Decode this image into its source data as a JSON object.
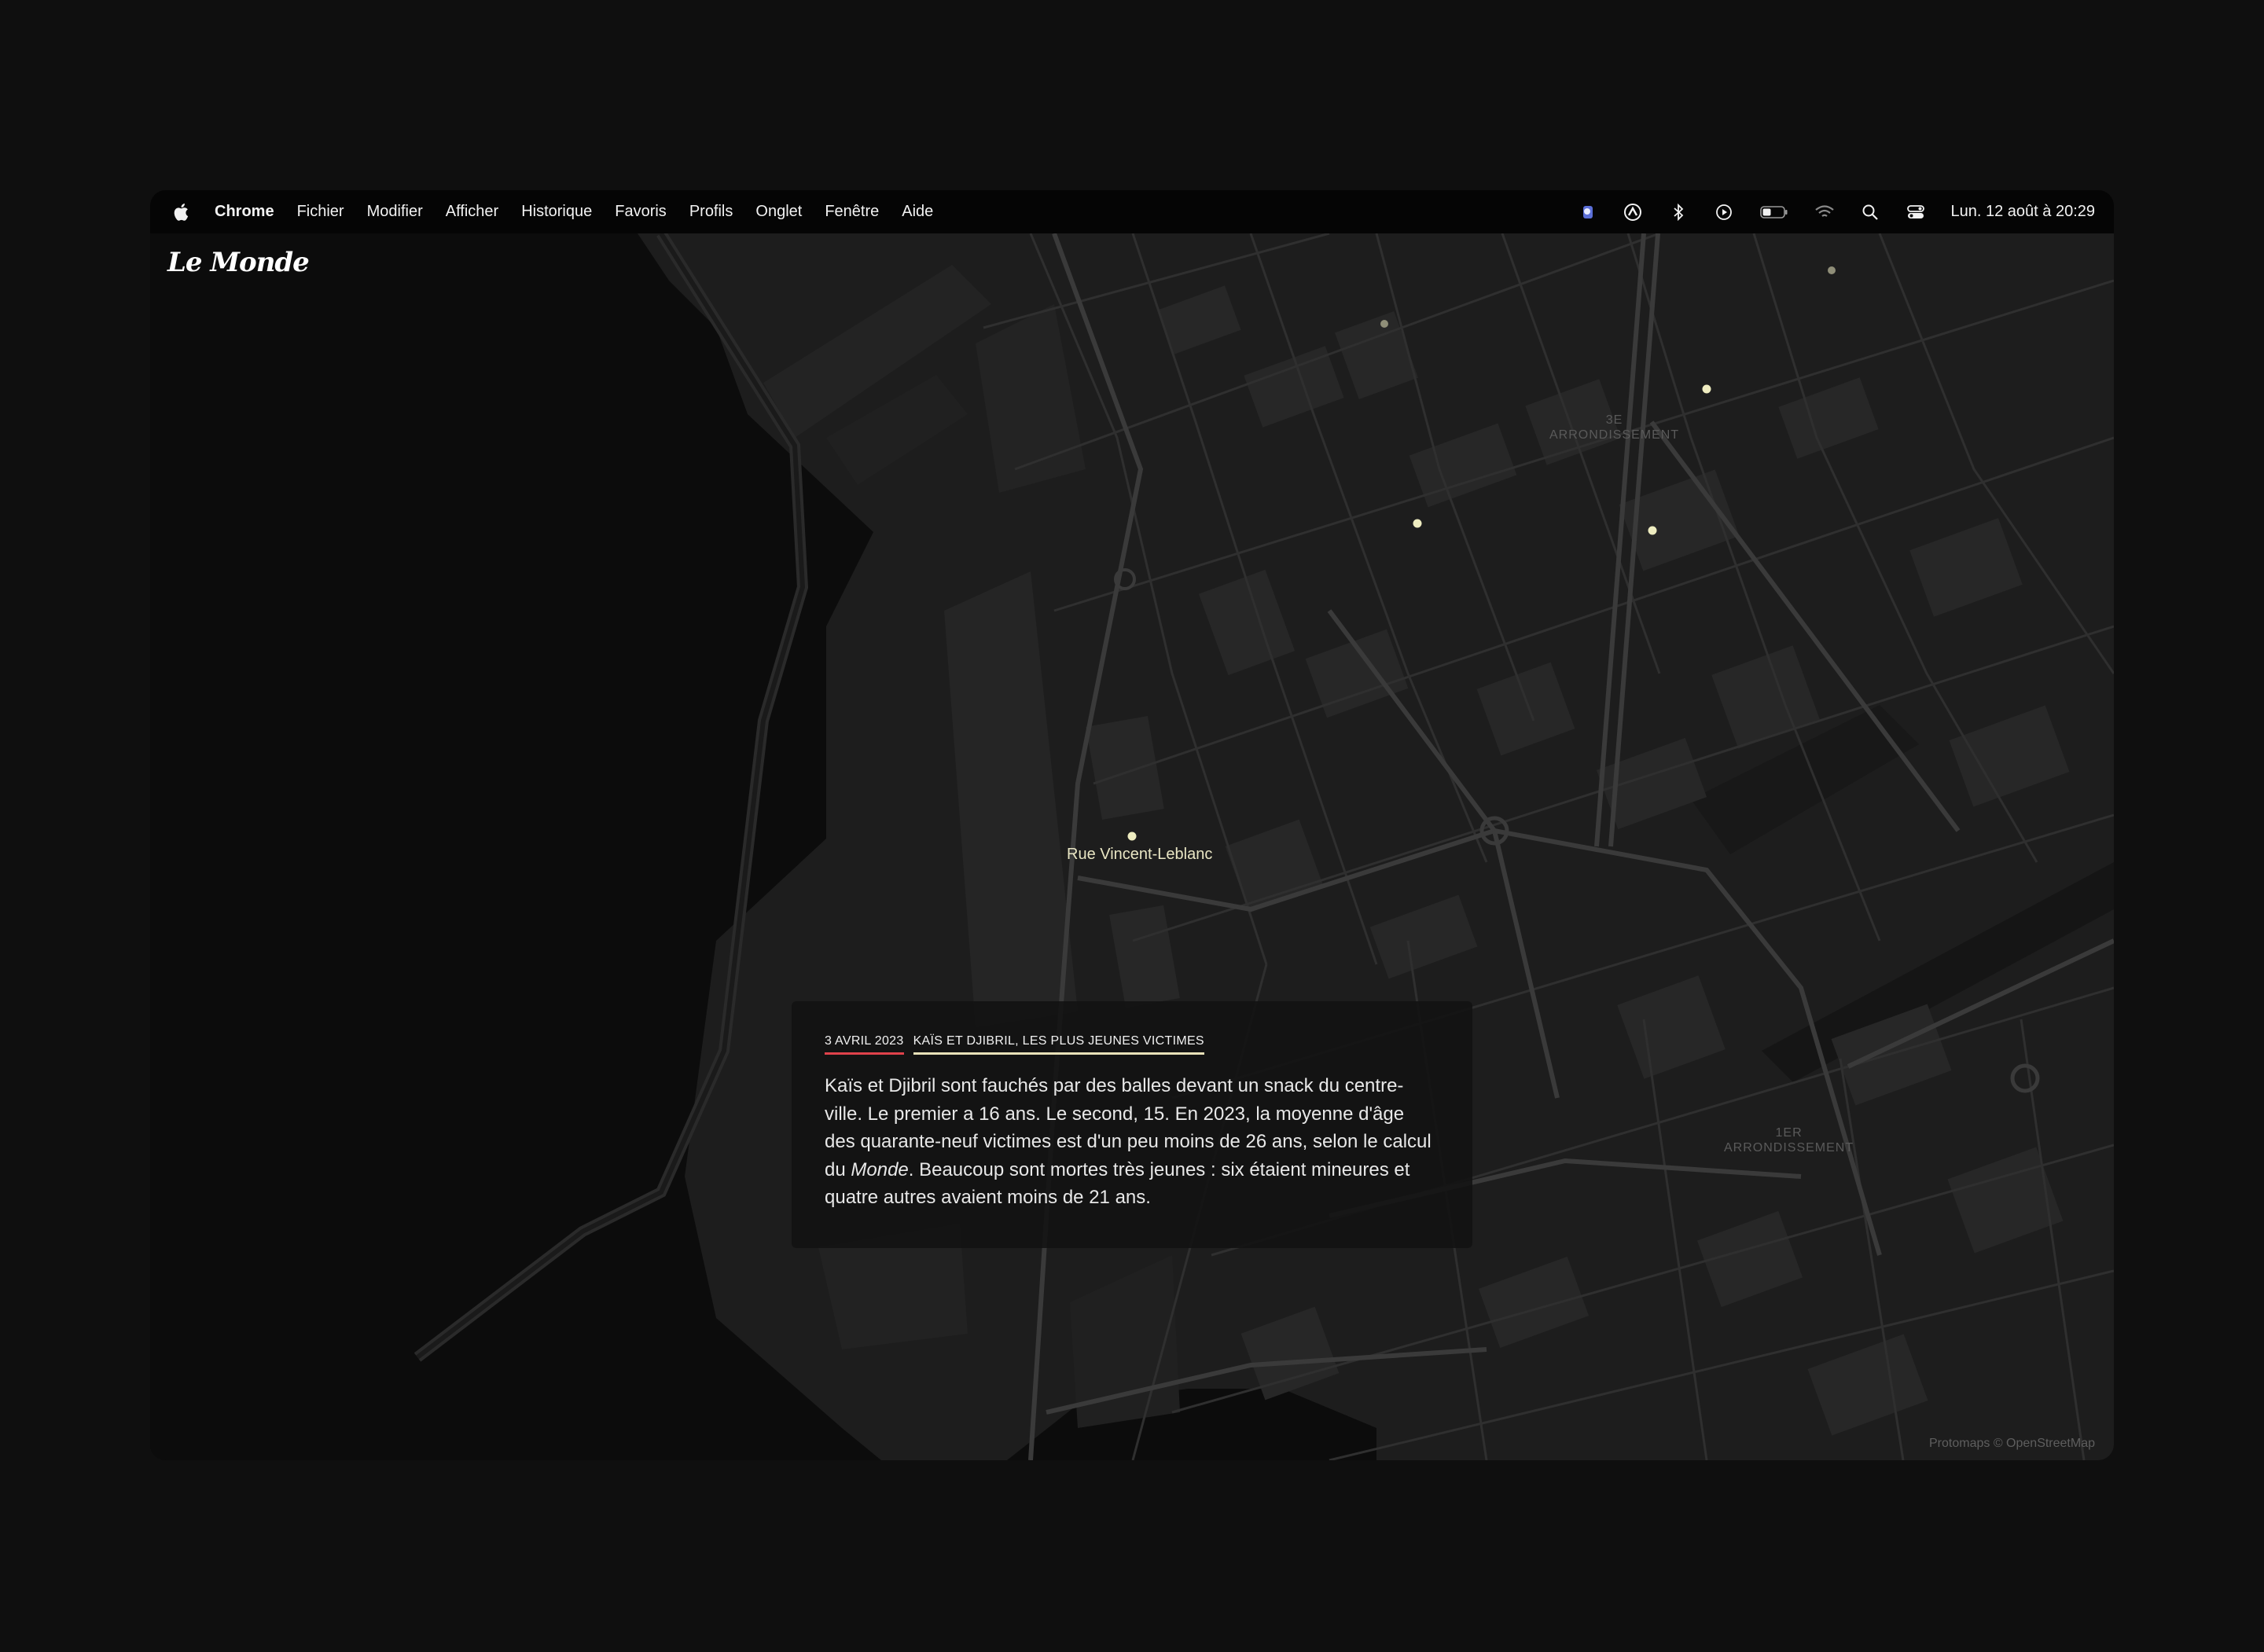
{
  "menubar": {
    "apple_icon": "apple-logo-icon",
    "app_name": "Chrome",
    "items": [
      "Fichier",
      "Modifier",
      "Afficher",
      "Historique",
      "Favoris",
      "Profils",
      "Onglet",
      "Fenêtre",
      "Aide"
    ],
    "status_icons": [
      "profile-icon",
      "vpn-icon",
      "bluetooth-icon",
      "play-icon",
      "battery-icon",
      "wifi-icon",
      "search-icon",
      "control-center-icon"
    ],
    "clock": "Lun. 12 août à  20:29"
  },
  "page": {
    "logo": "Le Monde",
    "districts": [
      {
        "line1": "3E",
        "line2": "ARRONDISSEMENT"
      },
      {
        "line1": "1ER",
        "line2": "ARRONDISSEMENT"
      }
    ],
    "street_label": "Rue Vincent-Leblanc",
    "attribution": "Protomaps © OpenStreetMap",
    "marker_color": "#eeecc0",
    "card": {
      "date": "3 AVRIL 2023",
      "topic": "KAÏS ET DJIBRIL, LES PLUS JEUNES VICTIMES",
      "text_before": "Kaïs et Djibril sont fauchés par des balles devant un snack du centre-ville. Le premier a 16 ans. Le second, 15. En 2023, la moyenne d'âge des quarante-neuf victimes est d'un peu moins de 26 ans, selon le calcul du ",
      "text_em": "Monde",
      "text_after": ". Beaucoup sont mortes très jeunes : six étaient mineures et quatre autres avaient moins de 21 ans."
    }
  }
}
